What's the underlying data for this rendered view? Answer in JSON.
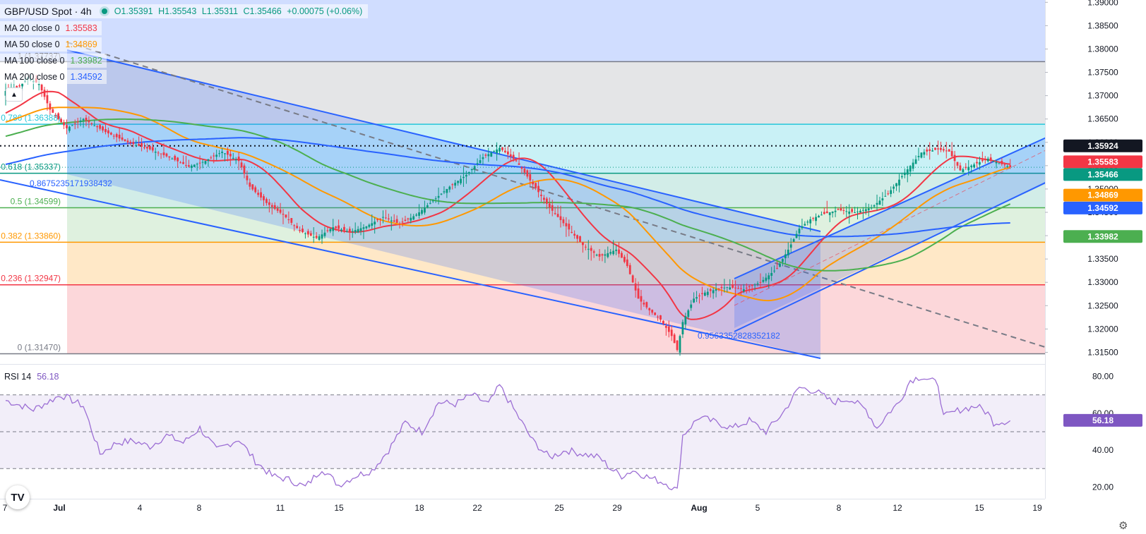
{
  "header": {
    "symbol": "GBP/USD Spot · 4h",
    "open": "O1.35391",
    "high": "H1.35543",
    "low": "L1.35311",
    "close": "C1.35466",
    "change": "+0.00075 (+0.06%)"
  },
  "mas": [
    {
      "label": "MA 20 close 0",
      "value": "1.35583",
      "color": "#f23645"
    },
    {
      "label": "MA 50 close 0",
      "value": "1.34869",
      "color": "#ff9800"
    },
    {
      "label": "MA 100 close 0",
      "value": "1.33982",
      "color": "#4caf50"
    },
    {
      "label": "MA 200 close 0",
      "value": "1.34592",
      "color": "#2962ff"
    }
  ],
  "rsi_header": {
    "label": "RSI 14",
    "value": "56.18",
    "color": "#7e57c2"
  },
  "colors": {
    "up": "#089981",
    "down": "#f23645",
    "ma20": "#f23645",
    "ma50": "#ff9800",
    "ma100": "#4caf50",
    "ma200": "#2962ff",
    "rsi": "#9c6ed4",
    "channel": "#2962ff"
  },
  "chart_data": [
    {
      "type": "candlestick",
      "title": "GBP/USD Spot · 4h",
      "ylim": [
        1.3125,
        1.3905
      ],
      "y_ticks": [
        "1.39000",
        "1.38500",
        "1.38000",
        "1.37500",
        "1.37000",
        "1.36500",
        "1.36000",
        "1.35500",
        "1.35000",
        "1.34500",
        "1.34000",
        "1.33500",
        "1.33000",
        "1.32500",
        "1.32000",
        "1.31500"
      ],
      "x_ticks": [
        "7",
        "Jul",
        "4",
        "8",
        "11",
        "15",
        "18",
        "22",
        "25",
        "29",
        "Aug",
        "5",
        "8",
        "12",
        "15",
        "19"
      ],
      "close_anchors": [
        [
          0,
          1.371
        ],
        [
          5,
          1.372
        ],
        [
          8,
          1.3738
        ],
        [
          12,
          1.3725
        ],
        [
          16,
          1.367
        ],
        [
          22,
          1.363
        ],
        [
          28,
          1.365
        ],
        [
          36,
          1.3622
        ],
        [
          44,
          1.36
        ],
        [
          52,
          1.3585
        ],
        [
          60,
          1.3565
        ],
        [
          66,
          1.3548
        ],
        [
          72,
          1.356
        ],
        [
          78,
          1.358
        ],
        [
          84,
          1.356
        ],
        [
          88,
          1.3505
        ],
        [
          94,
          1.347
        ],
        [
          100,
          1.3445
        ],
        [
          106,
          1.341
        ],
        [
          112,
          1.3395
        ],
        [
          118,
          1.3418
        ],
        [
          124,
          1.3408
        ],
        [
          130,
          1.342
        ],
        [
          136,
          1.344
        ],
        [
          142,
          1.3425
        ],
        [
          148,
          1.3445
        ],
        [
          154,
          1.3475
        ],
        [
          160,
          1.3505
        ],
        [
          166,
          1.353
        ],
        [
          172,
          1.3568
        ],
        [
          178,
          1.3588
        ],
        [
          184,
          1.356
        ],
        [
          190,
          1.351
        ],
        [
          196,
          1.346
        ],
        [
          202,
          1.342
        ],
        [
          208,
          1.338
        ],
        [
          214,
          1.3355
        ],
        [
          220,
          1.337
        ],
        [
          224,
          1.3335
        ],
        [
          228,
          1.3265
        ],
        [
          232,
          1.324
        ],
        [
          236,
          1.322
        ],
        [
          240,
          1.3185
        ],
        [
          242,
          1.3155
        ],
        [
          244,
          1.3215
        ],
        [
          248,
          1.3265
        ],
        [
          252,
          1.3278
        ],
        [
          256,
          1.3285
        ],
        [
          260,
          1.329
        ],
        [
          266,
          1.3285
        ],
        [
          272,
          1.33
        ],
        [
          278,
          1.333
        ],
        [
          282,
          1.337
        ],
        [
          286,
          1.3415
        ],
        [
          290,
          1.3435
        ],
        [
          294,
          1.3445
        ],
        [
          300,
          1.3455
        ],
        [
          306,
          1.345
        ],
        [
          312,
          1.346
        ],
        [
          318,
          1.349
        ],
        [
          324,
          1.3535
        ],
        [
          330,
          1.3578
        ],
        [
          336,
          1.3585
        ],
        [
          340,
          1.358
        ],
        [
          344,
          1.354
        ],
        [
          348,
          1.355
        ],
        [
          354,
          1.3565
        ],
        [
          358,
          1.3555
        ],
        [
          362,
          1.3547
        ]
      ],
      "fib_levels": [
        {
          "label": "0.786 (1.36388)",
          "value": 1.36388,
          "color": "#26c6da"
        },
        {
          "label": "0.618 (1.35337)",
          "value": 1.35337,
          "color": "#089981"
        },
        {
          "label": "0.5 (1.34599)",
          "value": 1.34599,
          "color": "#4caf50"
        },
        {
          "label": "0.382 (1.33860)",
          "value": 1.3386,
          "color": "#ff9800"
        },
        {
          "label": "0.236 (1.32947)",
          "value": 1.32947,
          "color": "#f23645"
        },
        {
          "label": "0 (1.31470)",
          "value": 1.3147,
          "color": "#787b86"
        }
      ],
      "fib_top": 1.3773,
      "fib_top_label": "1 (1.37737)",
      "dotted_level": 1.35924,
      "annotations": [
        "0.8675235171938432",
        "0.9563352828352182"
      ],
      "price_labels": [
        {
          "value": "1.35924",
          "price": 1.35924,
          "bg": "#131722"
        },
        {
          "value": "1.35583",
          "price": 1.35583,
          "bg": "#f23645"
        },
        {
          "value": "1.35466",
          "price": 1.35466,
          "bg": "#089981"
        },
        {
          "value": "1.34869",
          "price": 1.34869,
          "bg": "#ff9800"
        },
        {
          "value": "1.34592",
          "price": 1.34592,
          "bg": "#2962ff"
        },
        {
          "value": "1.33982",
          "price": 1.33982,
          "bg": "#4caf50"
        }
      ]
    },
    {
      "type": "line",
      "title": "RSI 14",
      "ylim": [
        14,
        86
      ],
      "y_ticks": [
        "80.00",
        "60.00",
        "40.00",
        "20.00"
      ],
      "levels": [
        70,
        50,
        30
      ],
      "last_value": "56.18",
      "anchors": [
        [
          0,
          67
        ],
        [
          10,
          62
        ],
        [
          20,
          70
        ],
        [
          28,
          64
        ],
        [
          34,
          38
        ],
        [
          40,
          44
        ],
        [
          46,
          45
        ],
        [
          52,
          42
        ],
        [
          58,
          48
        ],
        [
          64,
          44
        ],
        [
          70,
          52
        ],
        [
          76,
          40
        ],
        [
          84,
          46
        ],
        [
          90,
          34
        ],
        [
          96,
          26
        ],
        [
          102,
          24
        ],
        [
          108,
          20
        ],
        [
          114,
          30
        ],
        [
          120,
          21
        ],
        [
          126,
          26
        ],
        [
          132,
          29
        ],
        [
          138,
          40
        ],
        [
          144,
          55
        ],
        [
          150,
          50
        ],
        [
          156,
          66
        ],
        [
          162,
          65
        ],
        [
          168,
          70
        ],
        [
          174,
          65
        ],
        [
          178,
          75
        ],
        [
          184,
          60
        ],
        [
          190,
          45
        ],
        [
          196,
          36
        ],
        [
          202,
          40
        ],
        [
          208,
          38
        ],
        [
          214,
          36
        ],
        [
          218,
          30
        ],
        [
          222,
          26
        ],
        [
          226,
          29
        ],
        [
          232,
          25
        ],
        [
          238,
          22
        ],
        [
          242,
          18
        ],
        [
          244,
          48
        ],
        [
          250,
          58
        ],
        [
          256,
          55
        ],
        [
          262,
          52
        ],
        [
          268,
          56
        ],
        [
          274,
          50
        ],
        [
          280,
          60
        ],
        [
          286,
          74
        ],
        [
          292,
          72
        ],
        [
          298,
          66
        ],
        [
          304,
          68
        ],
        [
          310,
          62
        ],
        [
          314,
          52
        ],
        [
          318,
          60
        ],
        [
          322,
          66
        ],
        [
          326,
          78
        ],
        [
          330,
          80
        ],
        [
          336,
          76
        ],
        [
          338,
          58
        ],
        [
          344,
          62
        ],
        [
          350,
          64
        ],
        [
          354,
          60
        ],
        [
          356,
          55
        ],
        [
          362,
          56
        ]
      ]
    }
  ]
}
